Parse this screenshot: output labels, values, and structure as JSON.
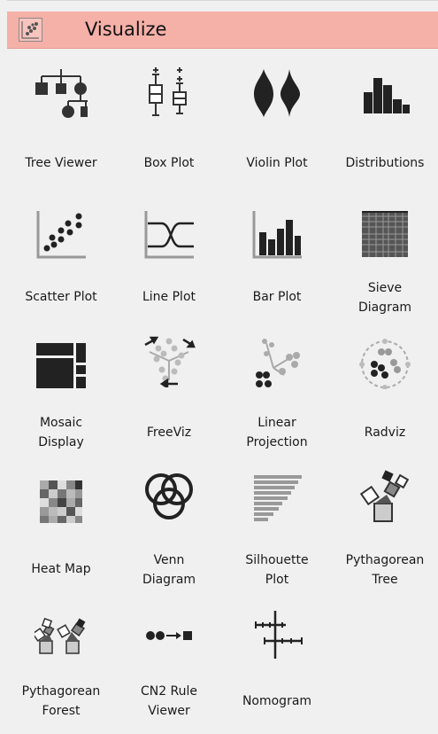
{
  "category": {
    "title": "Visualize",
    "icon": "scatter-category-icon",
    "accent_color": "#f5b0a8"
  },
  "widgets": [
    {
      "label": "Tree Viewer",
      "icon": "tree-viewer-icon"
    },
    {
      "label": "Box Plot",
      "icon": "box-plot-icon"
    },
    {
      "label": "Violin Plot",
      "icon": "violin-plot-icon"
    },
    {
      "label": "Distributions",
      "icon": "distributions-icon"
    },
    {
      "label": "Scatter Plot",
      "icon": "scatter-plot-icon"
    },
    {
      "label": "Line Plot",
      "icon": "line-plot-icon"
    },
    {
      "label": "Bar Plot",
      "icon": "bar-plot-icon"
    },
    {
      "label": "Sieve\nDiagram",
      "icon": "sieve-diagram-icon"
    },
    {
      "label": "Mosaic\nDisplay",
      "icon": "mosaic-display-icon"
    },
    {
      "label": "FreeViz",
      "icon": "freeviz-icon"
    },
    {
      "label": "Linear\nProjection",
      "icon": "linear-projection-icon"
    },
    {
      "label": "Radviz",
      "icon": "radviz-icon"
    },
    {
      "label": "Heat Map",
      "icon": "heat-map-icon"
    },
    {
      "label": "Venn\nDiagram",
      "icon": "venn-diagram-icon"
    },
    {
      "label": "Silhouette\nPlot",
      "icon": "silhouette-plot-icon"
    },
    {
      "label": "Pythagorean\nTree",
      "icon": "pythagorean-tree-icon"
    },
    {
      "label": "Pythagorean\nForest",
      "icon": "pythagorean-forest-icon"
    },
    {
      "label": "CN2 Rule\nViewer",
      "icon": "cn2-rule-viewer-icon"
    },
    {
      "label": "Nomogram",
      "icon": "nomogram-icon"
    }
  ]
}
